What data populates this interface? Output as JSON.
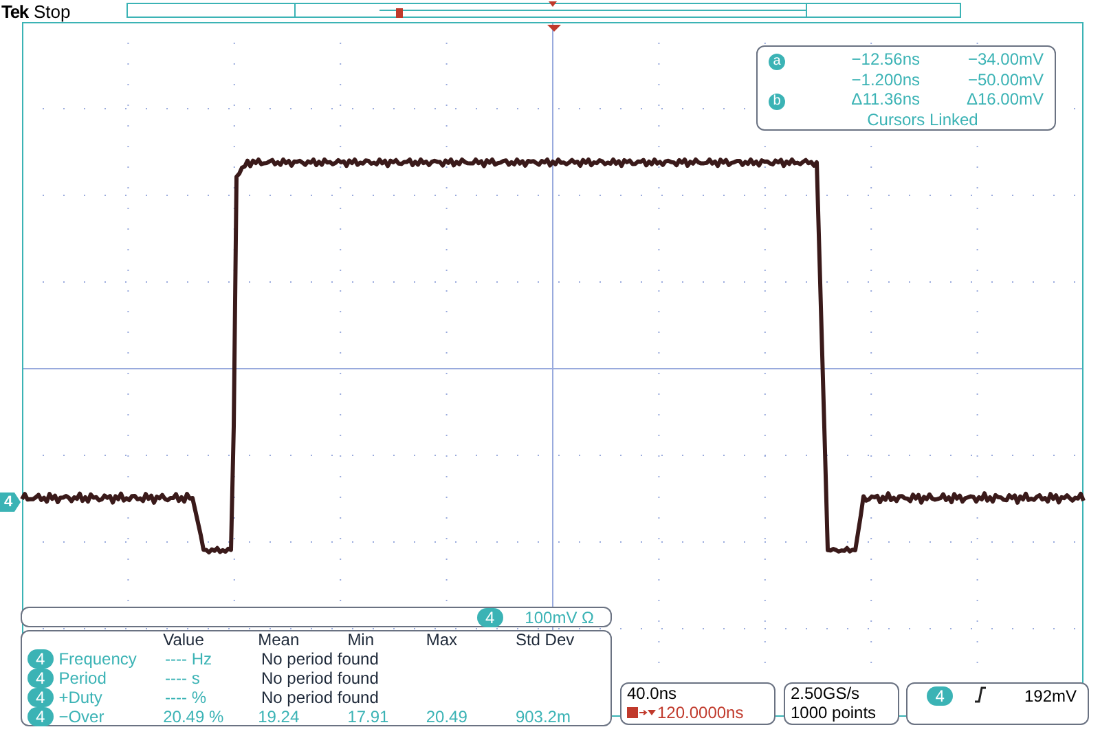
{
  "header": {
    "brand": "Tek",
    "status": "Stop"
  },
  "channel_marker": "4",
  "cursors": {
    "rows": [
      {
        "marker": "a",
        "time": "−12.56ns",
        "voltage": "−34.00mV"
      },
      {
        "marker": "",
        "time": "−1.200ns",
        "voltage": "−50.00mV"
      },
      {
        "marker": "b",
        "time": "Δ11.36ns",
        "voltage": "Δ16.00mV"
      }
    ],
    "footer": "Cursors Linked"
  },
  "channel_scale": {
    "channel": "4",
    "scale": "100mV Ω"
  },
  "measurements": {
    "columns": [
      "Value",
      "Mean",
      "Min",
      "Max",
      "Std Dev"
    ],
    "rows": [
      {
        "channel": "4",
        "name": "Frequency",
        "value": "---- Hz",
        "stats": [
          "No period found"
        ]
      },
      {
        "channel": "4",
        "name": "Period",
        "value": "---- s",
        "stats": [
          "No period found"
        ]
      },
      {
        "channel": "4",
        "name": "+Duty",
        "value": "---- %",
        "stats": [
          "No period found"
        ]
      },
      {
        "channel": "4",
        "name": "−Over",
        "value": "20.49 %",
        "stats": [
          "19.24",
          "17.91",
          "20.49",
          "903.2m"
        ]
      }
    ]
  },
  "timebase": {
    "scale": "40.0ns",
    "trigger_position": "120.0000ns"
  },
  "acquisition": {
    "rate": "2.50GS/s",
    "points": "1000 points"
  },
  "trigger": {
    "channel": "4",
    "level": "192mV"
  }
}
